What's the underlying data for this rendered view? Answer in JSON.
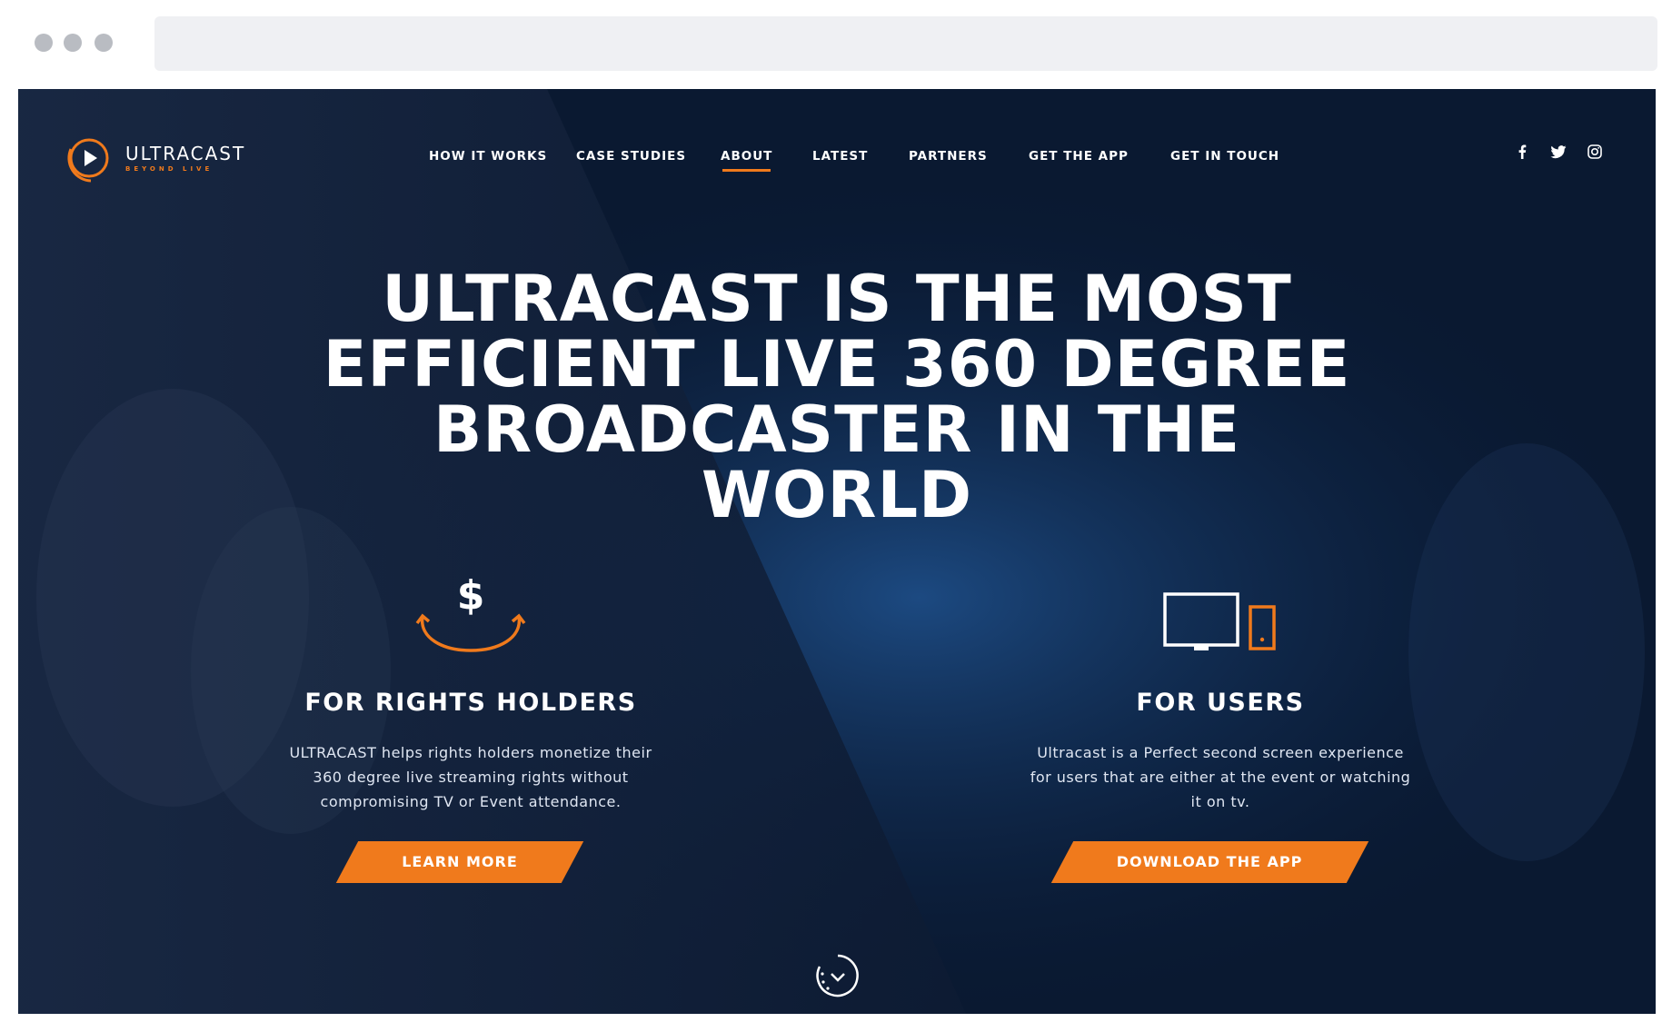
{
  "browser": {
    "url": ""
  },
  "brand": {
    "name": "ULTRACAST",
    "tagline": "BEYOND LIVE",
    "accent_color": "#f07a1c",
    "background_color": "#0a1a33"
  },
  "nav": {
    "items": [
      {
        "label": "HOW IT WORKS"
      },
      {
        "label": "CASE STUDIES"
      },
      {
        "label": "ABOUT",
        "active": true
      },
      {
        "label": "LATEST"
      },
      {
        "label": "PARTNERS"
      },
      {
        "label": "GET THE APP"
      },
      {
        "label": "GET IN TOUCH"
      }
    ]
  },
  "social": [
    "facebook-icon",
    "twitter-icon",
    "instagram-icon"
  ],
  "hero": {
    "title": "ULTRACAST IS THE MOST EFFICIENT LIVE 360 DEGREE BROADCASTER IN THE WORLD"
  },
  "features": {
    "rights_holders": {
      "icon": "dollar-cycle-icon",
      "heading": "FOR RIGHTS HOLDERS",
      "text": "ULTRACAST helps rights holders monetize their 360 degree live streaming rights without compromising TV or Event attendance.",
      "button": "LEARN MORE"
    },
    "users": {
      "icon": "devices-icon",
      "heading": "FOR USERS",
      "text": "Ultracast is a Perfect second screen experience for users that are either at the event or watching it on tv.",
      "button": "DOWNLOAD THE APP"
    }
  },
  "scroll_icon": "scroll-down-icon"
}
